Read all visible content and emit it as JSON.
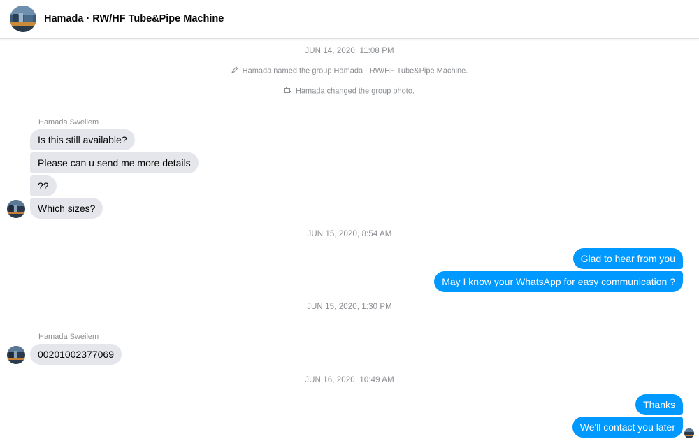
{
  "header": {
    "title": "Hamada · RW/HF Tube&Pipe Machine"
  },
  "thread": {
    "timestamp_1": "JUN 14, 2020, 11:08 PM",
    "system_1": "Hamada named the group Hamada · RW/HF Tube&Pipe Machine.",
    "system_2": "Hamada changed the group photo.",
    "sender_1": "Hamada Sweilem",
    "in_1": "Is this still available?",
    "in_2": "Please can u send me more details",
    "in_3": "??",
    "in_4": "Which sizes?",
    "timestamp_2": "JUN 15, 2020, 8:54 AM",
    "out_1": "Glad to hear from you",
    "out_2": "May I know your WhatsApp for easy communication ?",
    "timestamp_3": "JUN 15, 2020, 1:30 PM",
    "sender_2": "Hamada Sweilem",
    "in_5": "00201002377069",
    "timestamp_4": "JUN 16, 2020, 10:49 AM",
    "out_3": "Thanks",
    "out_4": "We'll contact you later"
  },
  "icons": {
    "rename": "pencil-icon",
    "photo": "photo-icon"
  },
  "colors": {
    "outgoing_bubble": "#0099ff",
    "incoming_bubble": "#e4e6eb",
    "meta_text": "#8a8d91"
  }
}
